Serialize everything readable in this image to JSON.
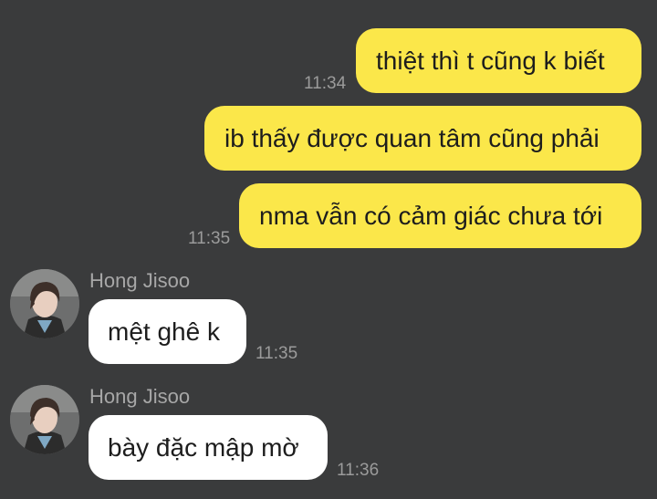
{
  "messages": [
    {
      "text": "thiệt thì t cũng k biết",
      "time": "11:34"
    },
    {
      "text": "ib thấy được quan tâm cũng phải"
    },
    {
      "text": "nma vẫn có cảm giác chưa tới",
      "time": "11:35"
    },
    {
      "sender": "Hong Jisoo",
      "text": "mệt ghê k",
      "time": "11:35"
    },
    {
      "sender": "Hong Jisoo",
      "text": "bày đặc mập mờ",
      "time": "11:36"
    }
  ],
  "colors": {
    "background": "#3a3b3c",
    "outgoing_bubble": "#fbe74a",
    "incoming_bubble": "#ffffff",
    "timestamp": "#9b9b9b",
    "sender_name": "#a7a7a7"
  },
  "icons": {
    "avatar": "profile-photo-avatar"
  }
}
